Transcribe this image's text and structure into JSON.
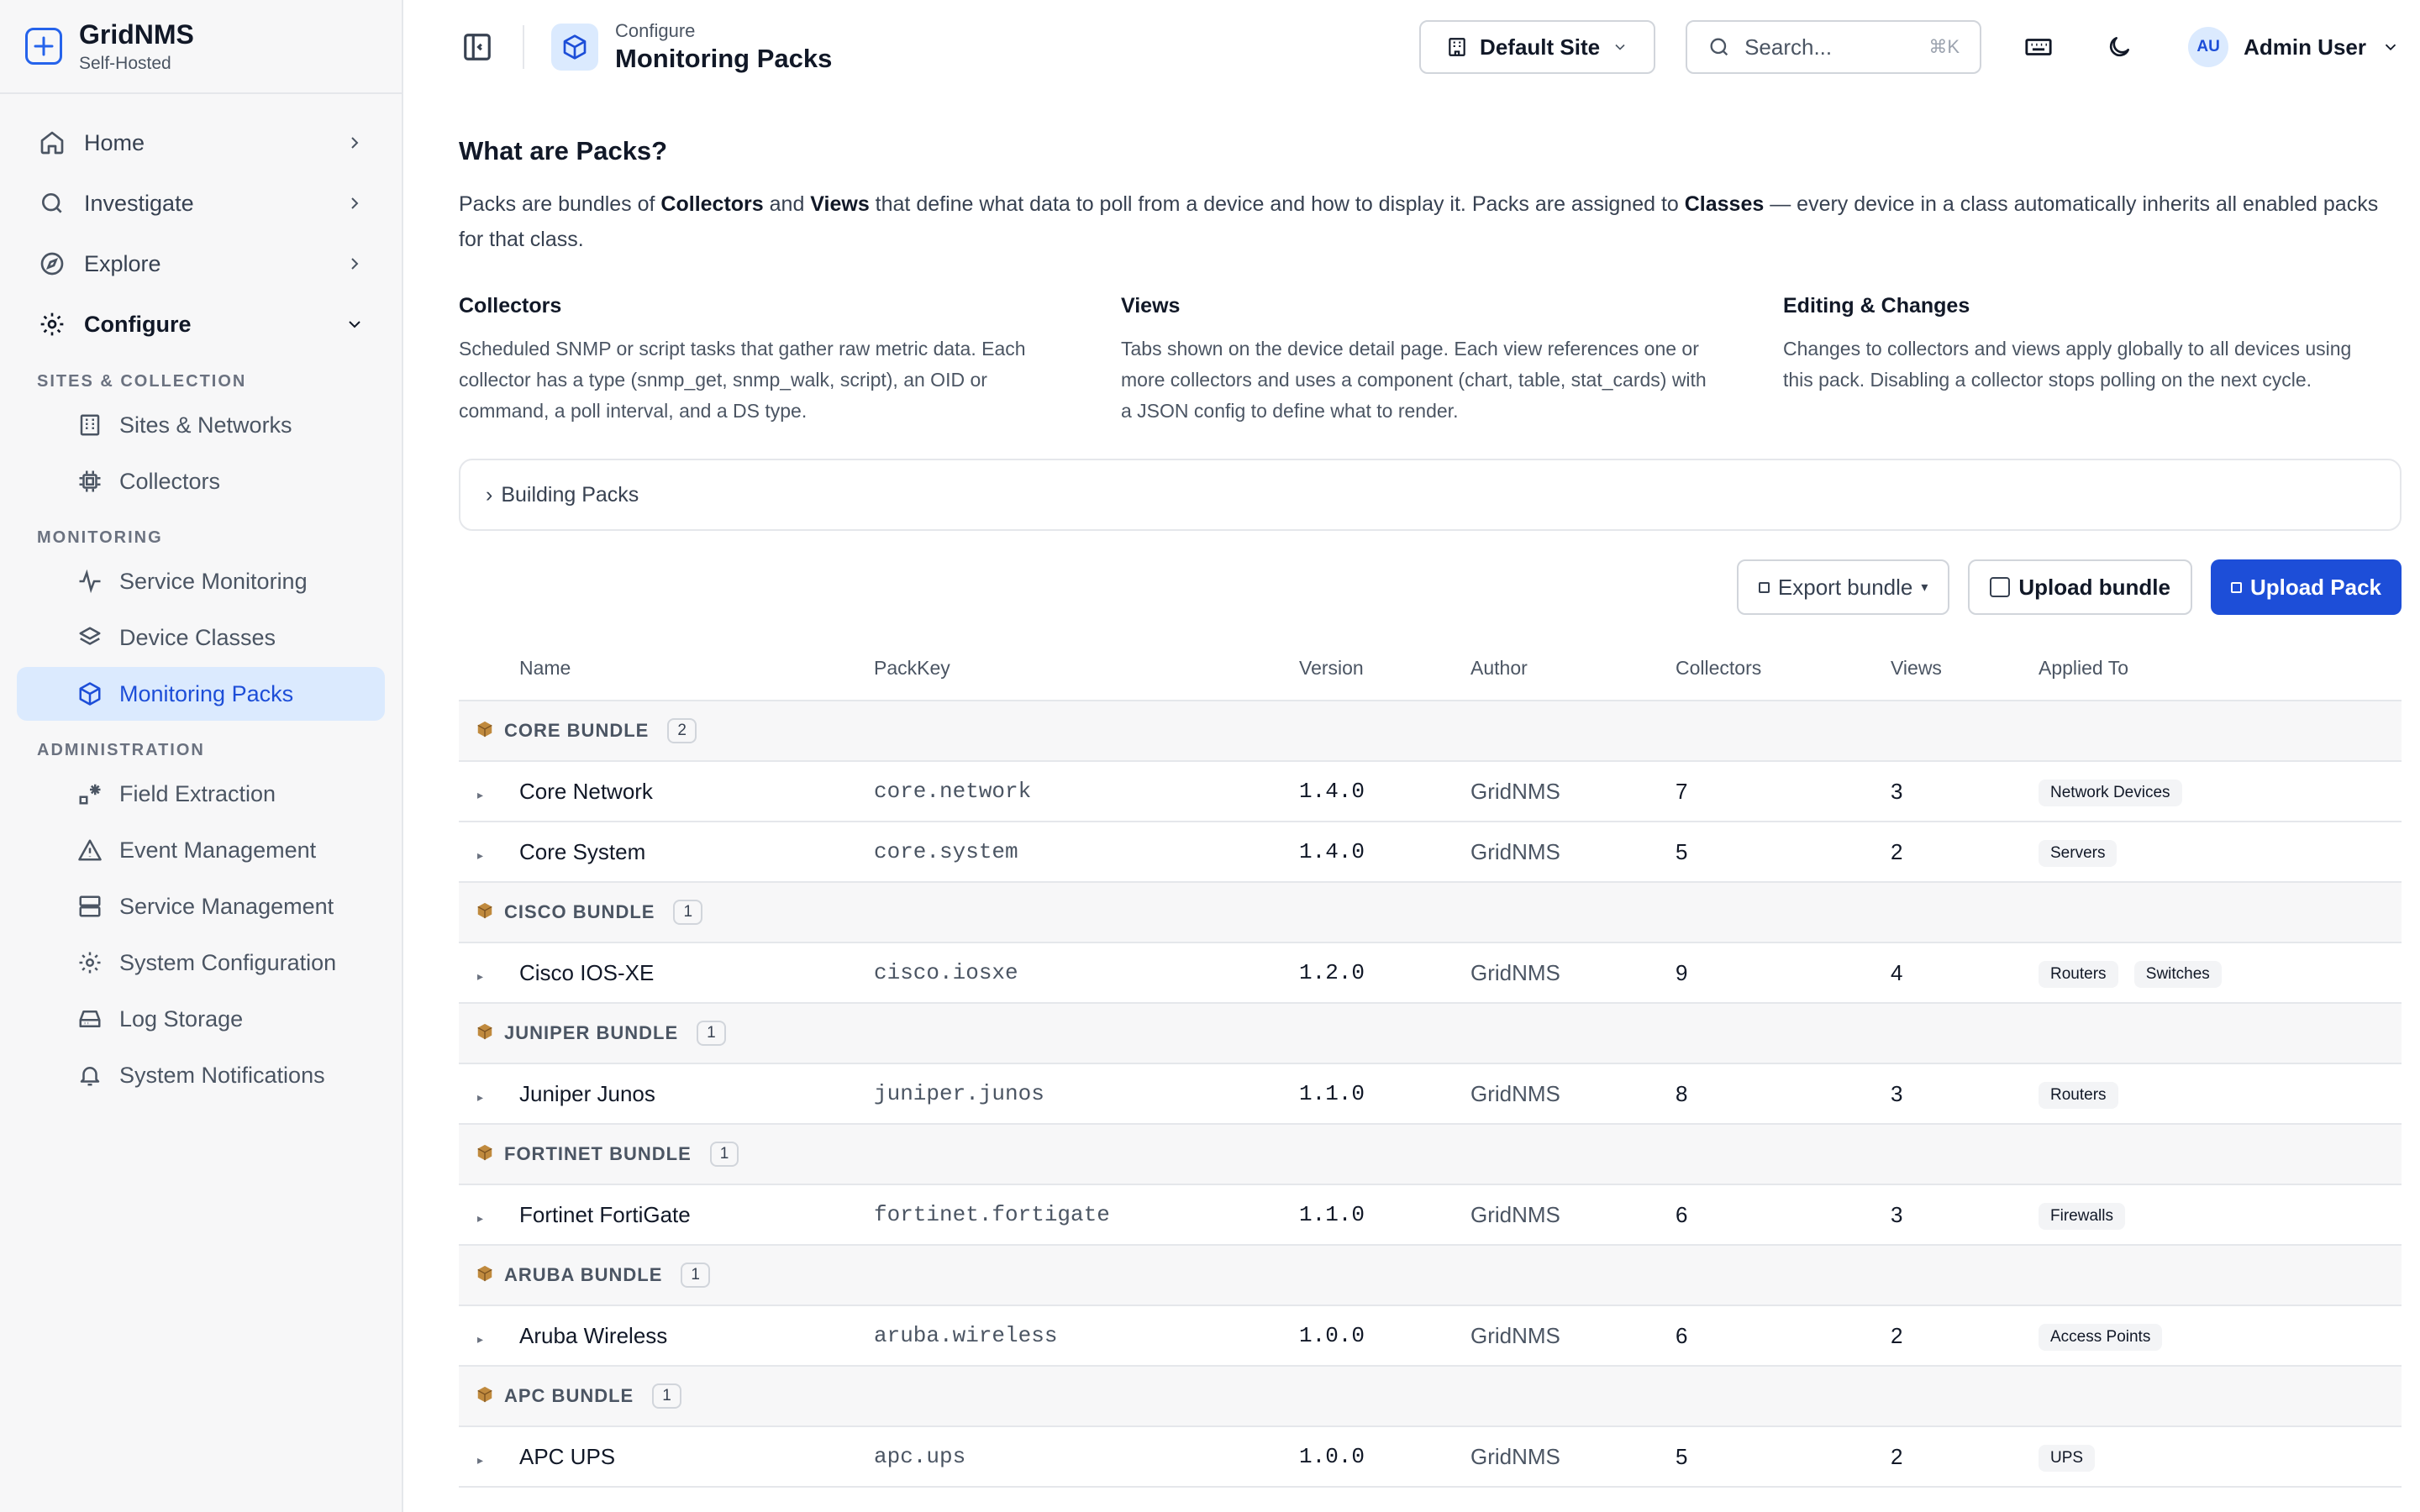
{
  "brand": {
    "name": "GridNMS",
    "subtitle": "Self-Hosted"
  },
  "sidebar": {
    "top": [
      {
        "label": "Home",
        "icon": "home-icon"
      },
      {
        "label": "Investigate",
        "icon": "search-icon"
      },
      {
        "label": "Explore",
        "icon": "compass-icon"
      },
      {
        "label": "Configure",
        "icon": "gear-icon",
        "expanded": true
      }
    ],
    "sections": [
      {
        "title": "SITES & COLLECTION",
        "items": [
          "Sites & Networks",
          "Collectors"
        ]
      },
      {
        "title": "MONITORING",
        "items": [
          "Service Monitoring",
          "Device Classes",
          "Monitoring Packs"
        ]
      },
      {
        "title": "ADMINISTRATION",
        "items": [
          "Field Extraction",
          "Event Management",
          "Service Management",
          "System Configuration",
          "Log Storage",
          "System Notifications"
        ]
      }
    ],
    "active_item": "Monitoring Packs"
  },
  "header": {
    "breadcrumb": "Configure",
    "title": "Monitoring Packs",
    "site": "Default Site",
    "search_placeholder": "Search...",
    "search_shortcut": "⌘K",
    "user_initials": "AU",
    "user_name": "Admin User"
  },
  "intro": {
    "title": "What are Packs?",
    "p1": "Packs are bundles of ",
    "b1": "Collectors",
    "p2": " and ",
    "b2": "Views",
    "p3": " that define what data to poll from a device and how to display it. Packs are assigned to ",
    "b3": "Classes",
    "p4": " — every device in a class automatically inherits all enabled packs for that class."
  },
  "columns": [
    {
      "title": "Collectors",
      "body": "Scheduled SNMP or script tasks that gather raw metric data. Each collector has a type (snmp_get, snmp_walk, script), an OID or command, a poll interval, and a DS type."
    },
    {
      "title": "Views",
      "body": "Tabs shown on the device detail page. Each view references one or more collectors and uses a component (chart, table, stat_cards) with a JSON config to define what to render."
    },
    {
      "title": "Editing & Changes",
      "body": "Changes to collectors and views apply globally to all devices using this pack. Disabling a collector stops polling on the next cycle."
    }
  ],
  "building_packs": "Building Packs",
  "actions": {
    "export": "Export bundle",
    "upload_bundle": "Upload bundle",
    "upload_pack": "Upload Pack"
  },
  "table": {
    "headers": [
      "Name",
      "PackKey",
      "Version",
      "Author",
      "Collectors",
      "Views",
      "Applied To"
    ],
    "groups": [
      {
        "name": "CORE BUNDLE",
        "count": "2",
        "rows": [
          {
            "name": "Core Network",
            "key": "core.network",
            "version": "1.4.0",
            "author": "GridNMS",
            "collectors": "7",
            "views": "3",
            "applied": [
              "Network Devices"
            ]
          },
          {
            "name": "Core System",
            "key": "core.system",
            "version": "1.4.0",
            "author": "GridNMS",
            "collectors": "5",
            "views": "2",
            "applied": [
              "Servers"
            ]
          }
        ]
      },
      {
        "name": "CISCO BUNDLE",
        "count": "1",
        "rows": [
          {
            "name": "Cisco IOS-XE",
            "key": "cisco.iosxe",
            "version": "1.2.0",
            "author": "GridNMS",
            "collectors": "9",
            "views": "4",
            "applied": [
              "Routers",
              "Switches"
            ]
          }
        ]
      },
      {
        "name": "JUNIPER BUNDLE",
        "count": "1",
        "rows": [
          {
            "name": "Juniper Junos",
            "key": "juniper.junos",
            "version": "1.1.0",
            "author": "GridNMS",
            "collectors": "8",
            "views": "3",
            "applied": [
              "Routers"
            ]
          }
        ]
      },
      {
        "name": "FORTINET BUNDLE",
        "count": "1",
        "rows": [
          {
            "name": "Fortinet FortiGate",
            "key": "fortinet.fortigate",
            "version": "1.1.0",
            "author": "GridNMS",
            "collectors": "6",
            "views": "3",
            "applied": [
              "Firewalls"
            ]
          }
        ]
      },
      {
        "name": "ARUBA BUNDLE",
        "count": "1",
        "rows": [
          {
            "name": "Aruba Wireless",
            "key": "aruba.wireless",
            "version": "1.0.0",
            "author": "GridNMS",
            "collectors": "6",
            "views": "2",
            "applied": [
              "Access Points"
            ]
          }
        ]
      },
      {
        "name": "APC BUNDLE",
        "count": "1",
        "rows": [
          {
            "name": "APC UPS",
            "key": "apc.ups",
            "version": "1.0.0",
            "author": "GridNMS",
            "collectors": "5",
            "views": "2",
            "applied": [
              "UPS"
            ]
          }
        ]
      }
    ]
  },
  "colors": {
    "accent": "#1d4ed8",
    "active_bg": "#dbeafe",
    "sidebar_bg": "#f7f7f8",
    "border": "#e5e7eb"
  }
}
